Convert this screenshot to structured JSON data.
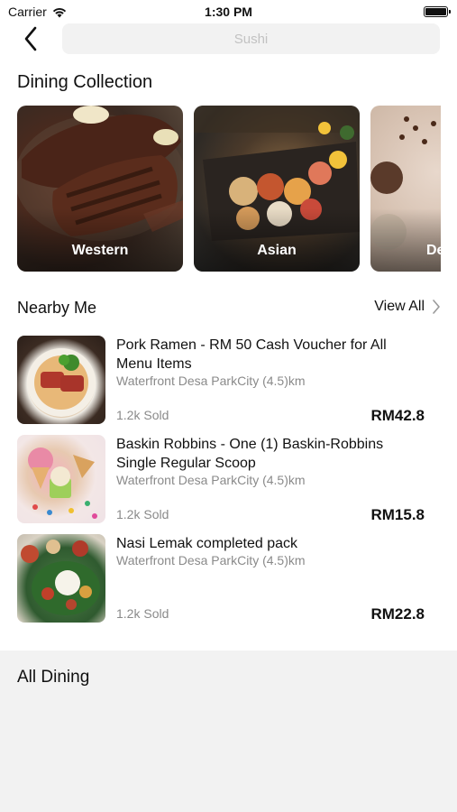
{
  "status_bar": {
    "carrier": "Carrier",
    "time": "1:30 PM"
  },
  "header": {
    "search_placeholder": "Sushi"
  },
  "collection": {
    "title": "Dining Collection",
    "cards": [
      {
        "label": "Western"
      },
      {
        "label": "Asian"
      },
      {
        "label": "De"
      }
    ]
  },
  "nearby": {
    "title": "Nearby Me",
    "view_all": "View All",
    "items": [
      {
        "name": "Pork Ramen - RM 50 Cash Voucher for All Menu Items",
        "location": "Waterfront Desa ParkCity (4.5)km",
        "sold": "1.2k Sold",
        "price": "RM42.8"
      },
      {
        "name": "Baskin Robbins - One (1) Baskin-Robbins Single Regular Scoop",
        "location": "Waterfront Desa ParkCity (4.5)km",
        "sold": "1.2k Sold",
        "price": "RM15.8"
      },
      {
        "name": "Nasi Lemak completed pack",
        "location": "Waterfront Desa ParkCity (4.5)km",
        "sold": "1.2k Sold",
        "price": "RM22.8"
      }
    ]
  },
  "all_dining": {
    "title": "All Dining"
  }
}
